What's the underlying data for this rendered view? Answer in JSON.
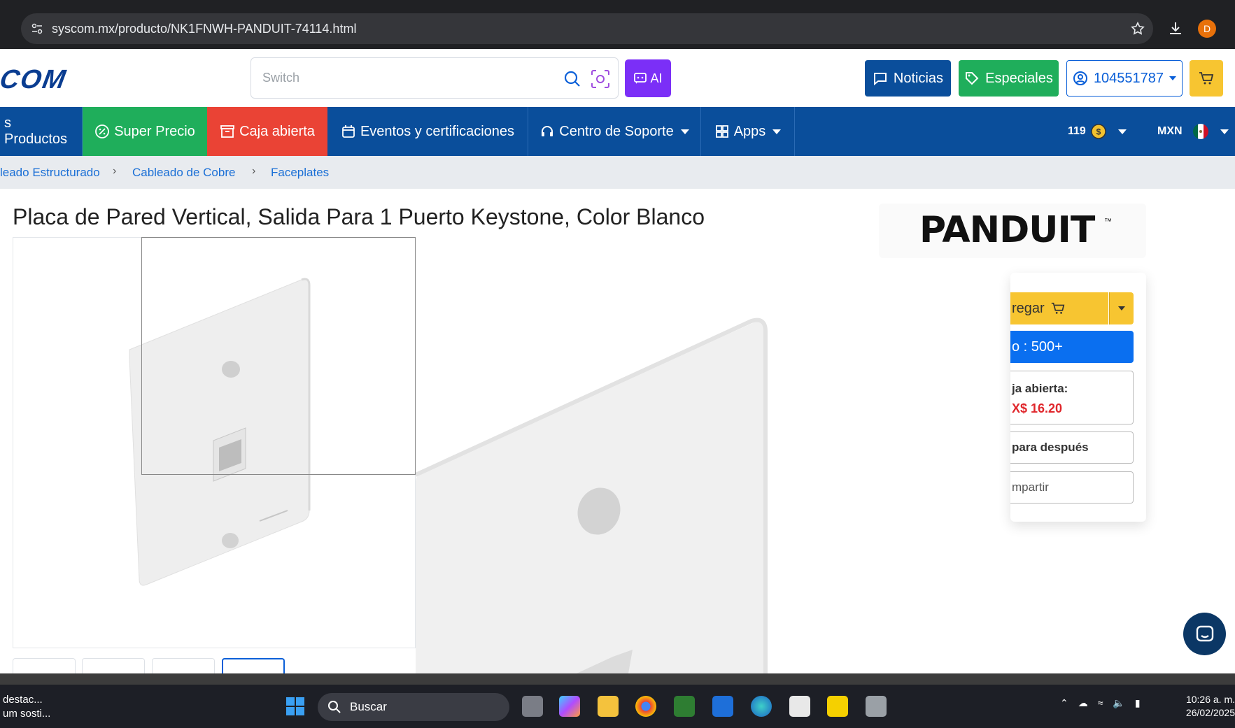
{
  "browser": {
    "url": "syscom.mx/producto/NK1FNWH-PANDUIT-74114.html",
    "profile_initial": "D"
  },
  "header": {
    "logo_text": "COM",
    "search_placeholder": "Switch",
    "ai_label": "AI",
    "noticias_label": "Noticias",
    "especiales_label": "Especiales",
    "account_label": "104551787"
  },
  "nav": {
    "productos": "s Productos",
    "super_precio": "Super Precio",
    "caja_abierta": "Caja abierta",
    "eventos": "Eventos y certificaciones",
    "soporte": "Centro de Soporte",
    "apps": "Apps",
    "points": "119",
    "currency": "MXN"
  },
  "breadcrumb": {
    "items": [
      "leado Estructurado",
      "Cableado de Cobre",
      "Faceplates"
    ],
    "separator": "›"
  },
  "product": {
    "title": "Placa de Pared Vertical, Salida Para 1 Puerto Keystone, Color Blanco",
    "brand": "PANDUIT",
    "brand_tm": "™"
  },
  "buy_panel": {
    "add_label": "regar",
    "stock_label": "o : 500+",
    "caja_label": "ja abierta:",
    "caja_price": "X$ 16.20",
    "later_label": "para después",
    "share_label": "mpartir"
  },
  "taskbar": {
    "news_line1": "destac...",
    "news_line2": "um sosti...",
    "search_label": "Buscar",
    "time": "10:26 a. m.",
    "date": "26/02/2025"
  },
  "colors": {
    "nav_blue": "#0a4e9b",
    "green": "#1fae5b",
    "red": "#ea4335",
    "yellow": "#f7c531",
    "purple": "#7b2ff7",
    "link_blue": "#1a6fd6",
    "price_red": "#e0262b"
  }
}
